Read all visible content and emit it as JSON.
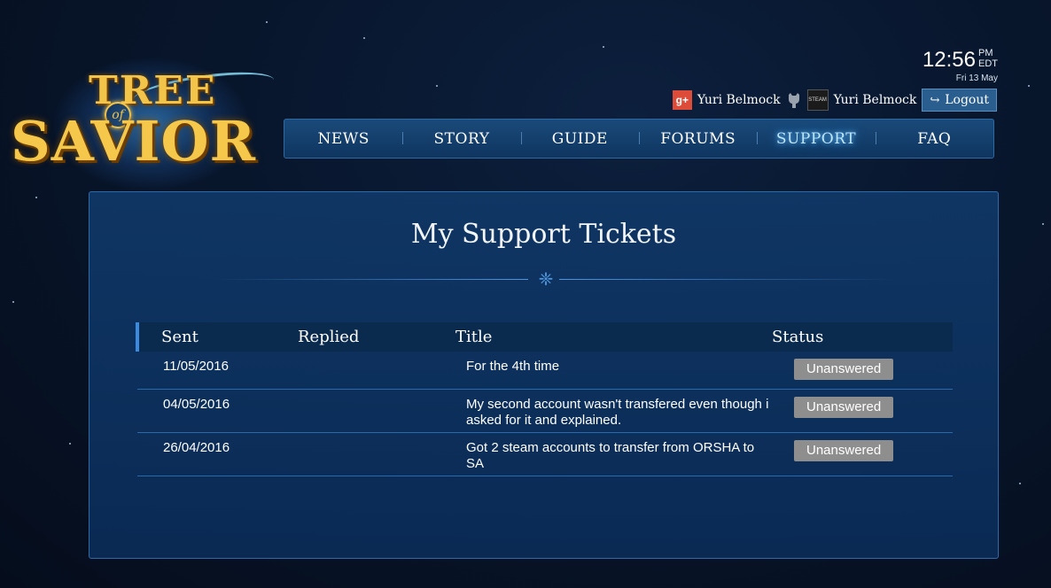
{
  "logo": {
    "word_top": "TREE",
    "word_of": "of",
    "word_bottom": "SAVIOR"
  },
  "clock": {
    "time": "12:56",
    "ampm": "PM",
    "tz": "EDT",
    "date": "Fri 13 May"
  },
  "user": {
    "gplus_name": "Yuri Belmock",
    "gplus_icon": "google-plus-icon",
    "github_icon": "github-icon",
    "steam_icon": "steam-icon",
    "steam_label": "STEAM",
    "steam_name": "Yuri Belmock",
    "logout_label": "Logout"
  },
  "nav": {
    "items": [
      "NEWS",
      "STORY",
      "GUIDE",
      "FORUMS",
      "SUPPORT",
      "FAQ"
    ],
    "active": "SUPPORT"
  },
  "page": {
    "title": "My Support Tickets"
  },
  "table": {
    "headers": {
      "sent": "Sent",
      "replied": "Replied",
      "title": "Title",
      "status": "Status"
    },
    "rows": [
      {
        "sent": "11/05/2016",
        "replied": "",
        "title": "For the 4th time",
        "status": "Unanswered"
      },
      {
        "sent": "04/05/2016",
        "replied": "",
        "title": "My second account wasn't transfered even though i asked for it and explained.",
        "status": "Unanswered"
      },
      {
        "sent": "26/04/2016",
        "replied": "",
        "title": "Got 2 steam accounts to transfer from ORSHA to SA",
        "status": "Unanswered"
      }
    ]
  },
  "colors": {
    "accent": "#3a8ae0",
    "badge": "#8e8e8e",
    "gplus": "#dd4b39",
    "gold": "#f3c44a"
  }
}
